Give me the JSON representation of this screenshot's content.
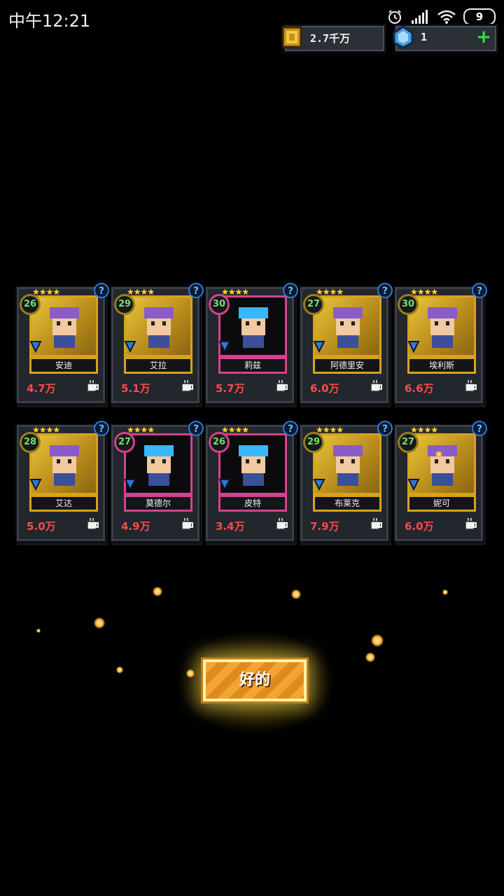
{
  "status_bar": {
    "time": "中午12:21",
    "battery": "9"
  },
  "currency": {
    "gold": "2.7千万",
    "gems": "1"
  },
  "heroes": [
    {
      "level": "26",
      "stars": "★★★★",
      "name": "安迪",
      "power": "4.7万",
      "frame": "gold"
    },
    {
      "level": "29",
      "stars": "★★★★",
      "name": "艾拉",
      "power": "5.1万",
      "frame": "gold"
    },
    {
      "level": "30",
      "stars": "★★★★",
      "name": "莉兹",
      "power": "5.7万",
      "frame": "pink"
    },
    {
      "level": "27",
      "stars": "★★★★",
      "name": "阿德里安",
      "power": "6.0万",
      "frame": "gold"
    },
    {
      "level": "30",
      "stars": "★★★★",
      "name": "埃利斯",
      "power": "6.6万",
      "frame": "gold"
    },
    {
      "level": "28",
      "stars": "★★★★",
      "name": "艾达",
      "power": "5.0万",
      "frame": "gold"
    },
    {
      "level": "27",
      "stars": "★★★★",
      "name": "莫德尔",
      "power": "4.9万",
      "frame": "pink"
    },
    {
      "level": "26",
      "stars": "★★★★",
      "name": "皮特",
      "power": "3.4万",
      "frame": "pink"
    },
    {
      "level": "29",
      "stars": "★★★★",
      "name": "布莱克",
      "power": "7.9万",
      "frame": "gold"
    },
    {
      "level": "27",
      "stars": "★★★★",
      "name": "妮可",
      "power": "6.0万",
      "frame": "gold"
    }
  ],
  "ok_button": "好的",
  "colors": {
    "gold_frame": "#d7a21e",
    "pink_frame": "#d6418e",
    "power_text": "#ff4a4a",
    "level_text": "#74e06a"
  },
  "icons": {
    "info": "question-mark-icon",
    "element": "element-icon",
    "cost": "coffee-cup-icon"
  }
}
